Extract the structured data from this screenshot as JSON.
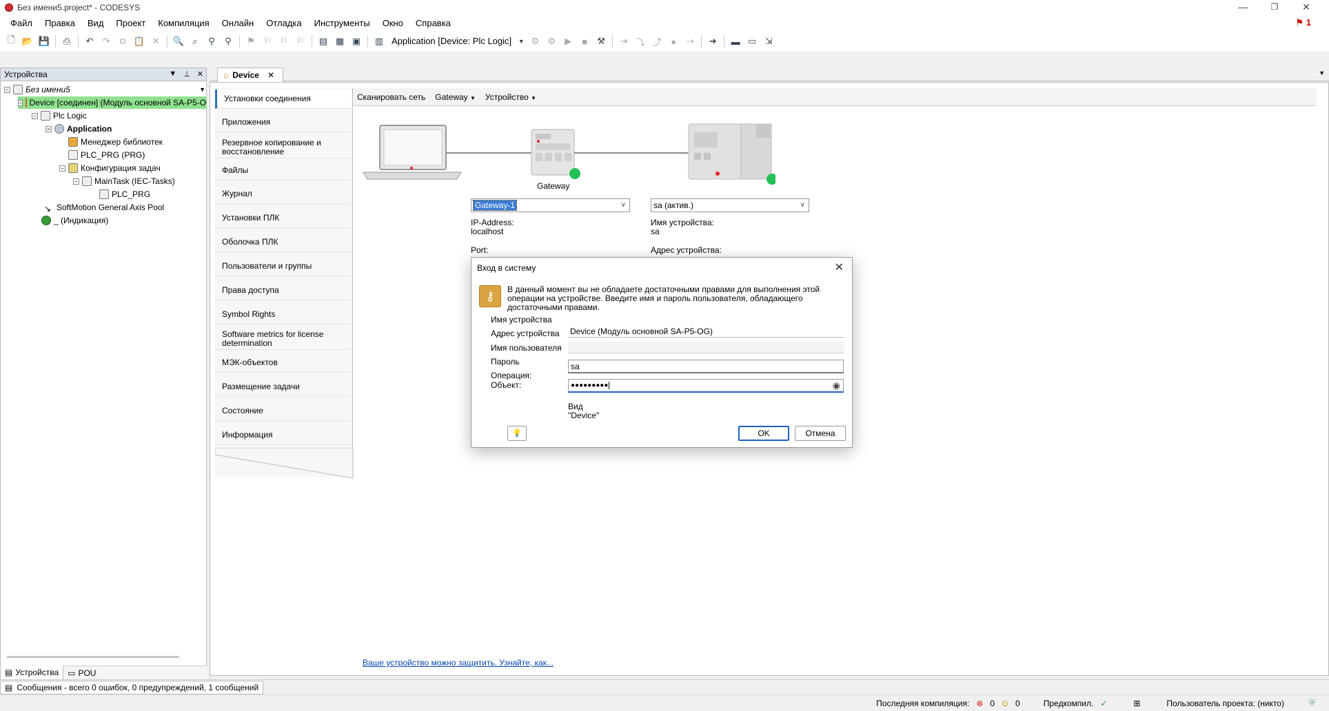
{
  "window": {
    "title": "Без имени5.project* - CODESYS",
    "minimize": "—",
    "maximize": "❐",
    "close": "✕"
  },
  "menu": [
    "Файл",
    "Правка",
    "Вид",
    "Проект",
    "Компиляция",
    "Онлайн",
    "Отладка",
    "Инструменты",
    "Окно",
    "Справка"
  ],
  "flag_count": "1",
  "toolbar": {
    "application_selector": "Application [Device: Plc Logic]"
  },
  "devices_pane": {
    "title": "Устройства",
    "tree": [
      {
        "label": "Без имени5",
        "level": 0
      },
      {
        "label": "Device [соединен] (Модуль основной SA-P5-OG)",
        "level": 1
      },
      {
        "label": "Plc Logic",
        "level": 2
      },
      {
        "label": "Application",
        "level": 3
      },
      {
        "label": "Менеджер библиотек",
        "level": 4
      },
      {
        "label": "PLC_PRG (PRG)",
        "level": 4
      },
      {
        "label": "Конфигурация задач",
        "level": 4
      },
      {
        "label": "MainTask (IEC-Tasks)",
        "level": 5
      },
      {
        "label": "PLC_PRG",
        "level": 6
      },
      {
        "label": "SoftMotion General Axis Pool",
        "level": 2
      },
      {
        "label": "_ (Индикация)",
        "level": 2
      }
    ],
    "bottom_tabs": [
      "Устройства",
      "POU"
    ]
  },
  "editor": {
    "tab_label": "Device",
    "nav": [
      "Установки соединения",
      "Приложения",
      "Резервное копирование и восстановление",
      "Файлы",
      "Журнал",
      "Установки ПЛК",
      "Оболочка ПЛК",
      "Пользователи и группы",
      "Права доступа",
      "Symbol Rights",
      "Software metrics for license determination",
      "МЭК-объектов",
      "Размещение задачи",
      "Состояние",
      "Информация"
    ],
    "subtoolbar": {
      "scan": "Сканировать сеть",
      "gateway": "Gateway",
      "device": "Устройство"
    },
    "gateway_label": "Gateway",
    "gateway_combo": "Gateway-1",
    "device_combo": "sa (актив.)",
    "ip_label": "IP-Address:",
    "ip_value": "localhost",
    "port_label": "Port:",
    "device_name_label": "Имя устройства:",
    "device_name_value": "sa",
    "device_addr_label": "Адрес устройства:",
    "protect_link": "Ваше устройство можно защитить. Узнайте, как..."
  },
  "login_dialog": {
    "title": "Вход в систему",
    "message": "В данный момент вы не обладаете достаточными правами для выполнения этой операции на устройстве. Введите имя и пароль пользователя, обладающего достаточными правами.",
    "labels": {
      "device_name": "Имя устройства",
      "device_address": "Адрес устройства",
      "username": "Имя пользователя",
      "password": "Пароль",
      "operation": "Операция:",
      "object": "Объект:"
    },
    "device_address_value": "Device (Модуль основной SA-P5-OG)",
    "username_value": "sa",
    "password_value": "●●●●●●●●●",
    "kind_label": "Вид",
    "kind_value": "\"Device\"",
    "ok": "OK",
    "cancel": "Отмена"
  },
  "status": {
    "messages": "Сообщения - всего 0 ошибок, 0 предупреждений, 1 сообщений",
    "last_compile": "Последняя компиляция:",
    "errors": "0",
    "warnings": "0",
    "precompile": "Предкомпил.",
    "project_user": "Пользователь проекта: (никто)"
  }
}
